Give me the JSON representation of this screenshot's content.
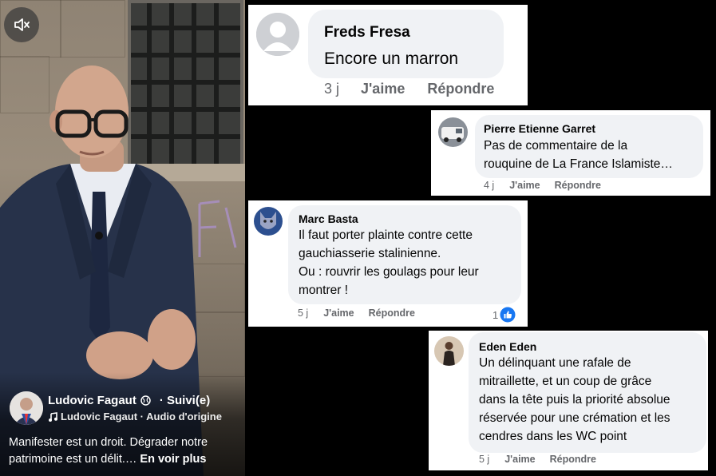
{
  "video": {
    "author_name": "Ludovic Fagaut",
    "follow_label": "· Suivi(e)",
    "audio_label": "Ludovic Fagaut · Audio d'origine",
    "caption": "Manifester est un droit. Dégrader notre patrimoine est un délit.…",
    "see_more": "En voir plus",
    "icons": {
      "mute": "speaker-muted-icon",
      "globe": "globe-icon",
      "music": "music-note-icon"
    }
  },
  "comments": [
    {
      "name": "Freds Fresa",
      "text": [
        "Encore un marron"
      ],
      "time": "3 j",
      "like": "J'aime",
      "reply": "Répondre"
    },
    {
      "name": "Pierre Etienne Garret",
      "text": [
        "Pas de commentaire de la",
        "rouquine de La France Islamiste…"
      ],
      "time": "4 j",
      "like": "J'aime",
      "reply": "Répondre"
    },
    {
      "name": "Marc Basta",
      "text": [
        "Il faut porter plainte contre cette",
        "gauchiasserie stalinienne.",
        "Ou : rouvrir les goulags pour leur",
        "montrer !"
      ],
      "time": "5 j",
      "like": "J'aime",
      "reply": "Répondre",
      "reactions": "1"
    },
    {
      "name": "Eden Eden",
      "text": [
        "Un délinquant une rafale de",
        "mitraillette, et un coup de grâce",
        "dans la tête puis la priorité absolue",
        "réservée pour une crémation et les",
        "cendres dans les WC point"
      ],
      "time": "5 j",
      "like": "J'aime",
      "reply": "Répondre"
    }
  ],
  "colors": {
    "bubble": "#f0f2f5",
    "action_gray": "#65676b",
    "like_blue": "#1877f2"
  }
}
